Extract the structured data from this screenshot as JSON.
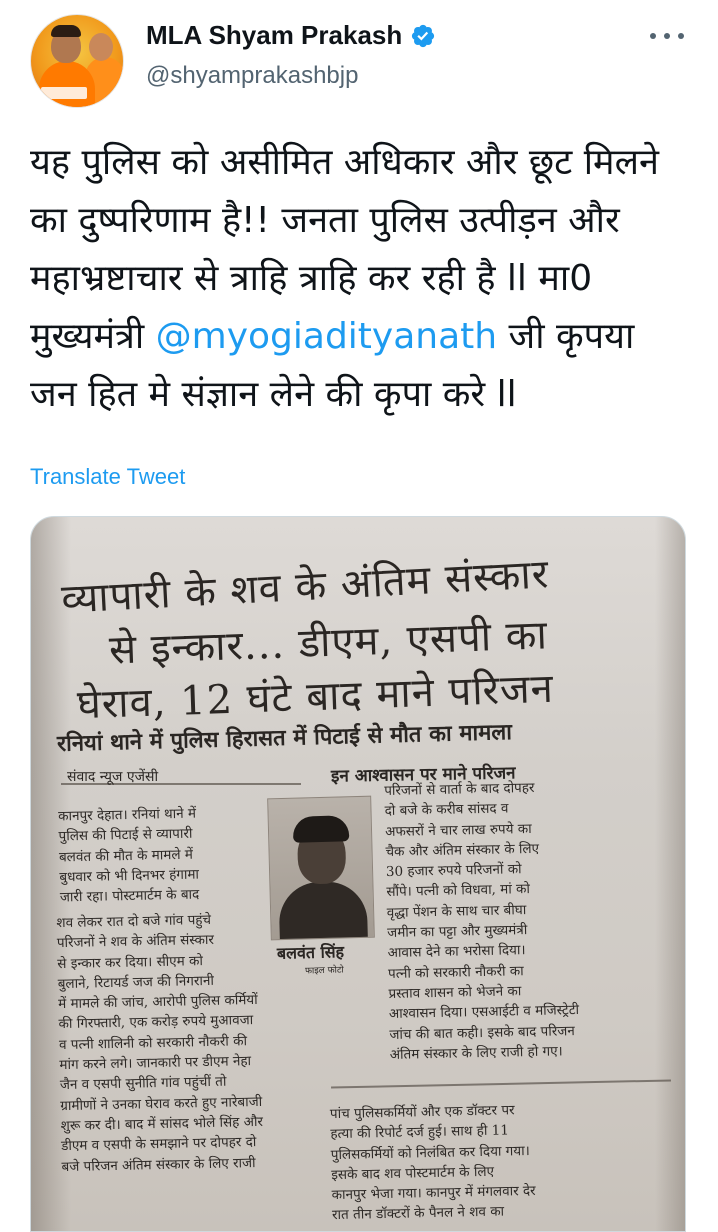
{
  "tweet": {
    "display_name": "MLA Shyam Prakash",
    "handle": "@shyamprakashbjp",
    "text_before_mention": "यह पुलिस को असीमित अधिकार और छूट मिलने का दुष्परिणाम है!! जनता पुलिस उत्पीड़न और महाभ्रष्टाचार से त्राहि त्राहि कर रही है ll मा0 मुख्यमंत्री ",
    "mention": "@myogiadityanath",
    "text_after_mention": " जी कृपया जन हित मे संज्ञान लेने की कृपा करे ll",
    "translate_label": "Translate Tweet",
    "verified_color": "#1d9bf0"
  },
  "icons": {
    "verified": "verified-badge-icon",
    "more": "more-options-icon"
  },
  "newspaper": {
    "headline_line1": "व्यापारी के शव के अंतिम संस्कार",
    "headline_line2": "से इन्कार... डीएम, एसपी का",
    "headline_line3": "घेराव, 12 घंटे बाद माने परिजन",
    "subheadline": "रनियां थाने में पुलिस हिरासत में पिटाई से मौत का मामला",
    "byline": "संवाद न्यूज एजेंसी",
    "right_subhead": "इन आश्वासन पर माने परिजन",
    "left_col_top": [
      "कानपुर देहात। रनियां थाने में",
      "पुलिस की पिटाई से व्यापारी",
      "बलवंत की मौत के मामले में",
      "बुधवार को भी दिनभर हंगामा",
      "जारी रहा। पोस्टमार्टम के बाद"
    ],
    "left_col_bottom": [
      "शव लेकर रात दो बजे गांव पहुंचे",
      "परिजनों ने शव के अंतिम संस्कार",
      "से इन्कार कर दिया। सीएम को",
      "बुलाने, रिटायर्ड जज की निगरानी",
      "में मामले की जांच, आरोपी पुलिस कर्मियों",
      "की गिरफ्तारी, एक करोड़ रुपये मुआवजा",
      "व पत्नी शालिनी को सरकारी नौकरी की",
      "मांग करने लगे। जानकारी पर डीएम नेहा",
      "जैन व एसपी सुनीति गांव पहुंचीं तो",
      "ग्रामीणों ने उनका घेराव करते हुए नारेबाजी",
      "शुरू कर दी। बाद में सांसद भोले सिंह और",
      "डीएम व एसपी के समझाने पर दोपहर दो",
      "बजे परिजन अंतिम संस्कार के लिए राजी"
    ],
    "right_col_top": [
      "परिजनों से वार्ता के बाद दोपहर",
      "दो बजे के करीब सांसद व",
      "अफसरों ने चार लाख रुपये का",
      "चैक और अंतिम संस्कार के लिए",
      "30 हजार रुपये परिजनों को",
      "सौंपे। पत्नी को विधवा, मां को",
      "वृद्धा पेंशन के साथ चार बीघा",
      "जमीन का पट्टा और मुख्यमंत्री",
      "आवास देने का भरोसा दिया।",
      "पत्नी को सरकारी नौकरी का",
      "प्रस्ताव शासन को भेजने का",
      "आश्वासन दिया। एसआईटी व मजिस्ट्रेटी",
      "जांच की बात कही। इसके बाद परिजन",
      "अंतिम संस्कार के लिए राजी हो गए।"
    ],
    "right_col_bottom": [
      "पांच पुलिसकर्मियों और एक डॉक्टर पर",
      "हत्या की रिपोर्ट दर्ज हुई। साथ ही 11",
      "पुलिसकर्मियों को निलंबित कर दिया गया।",
      "इसके बाद शव पोस्टमार्टम के लिए",
      "कानपुर भेजा गया। कानपुर में मंगलवार देर",
      "रात तीन डॉक्टरों के पैनल ने शव का"
    ],
    "photo_caption": "बलवंत सिंह",
    "photo_caption_small": "फाइल फोटो"
  }
}
